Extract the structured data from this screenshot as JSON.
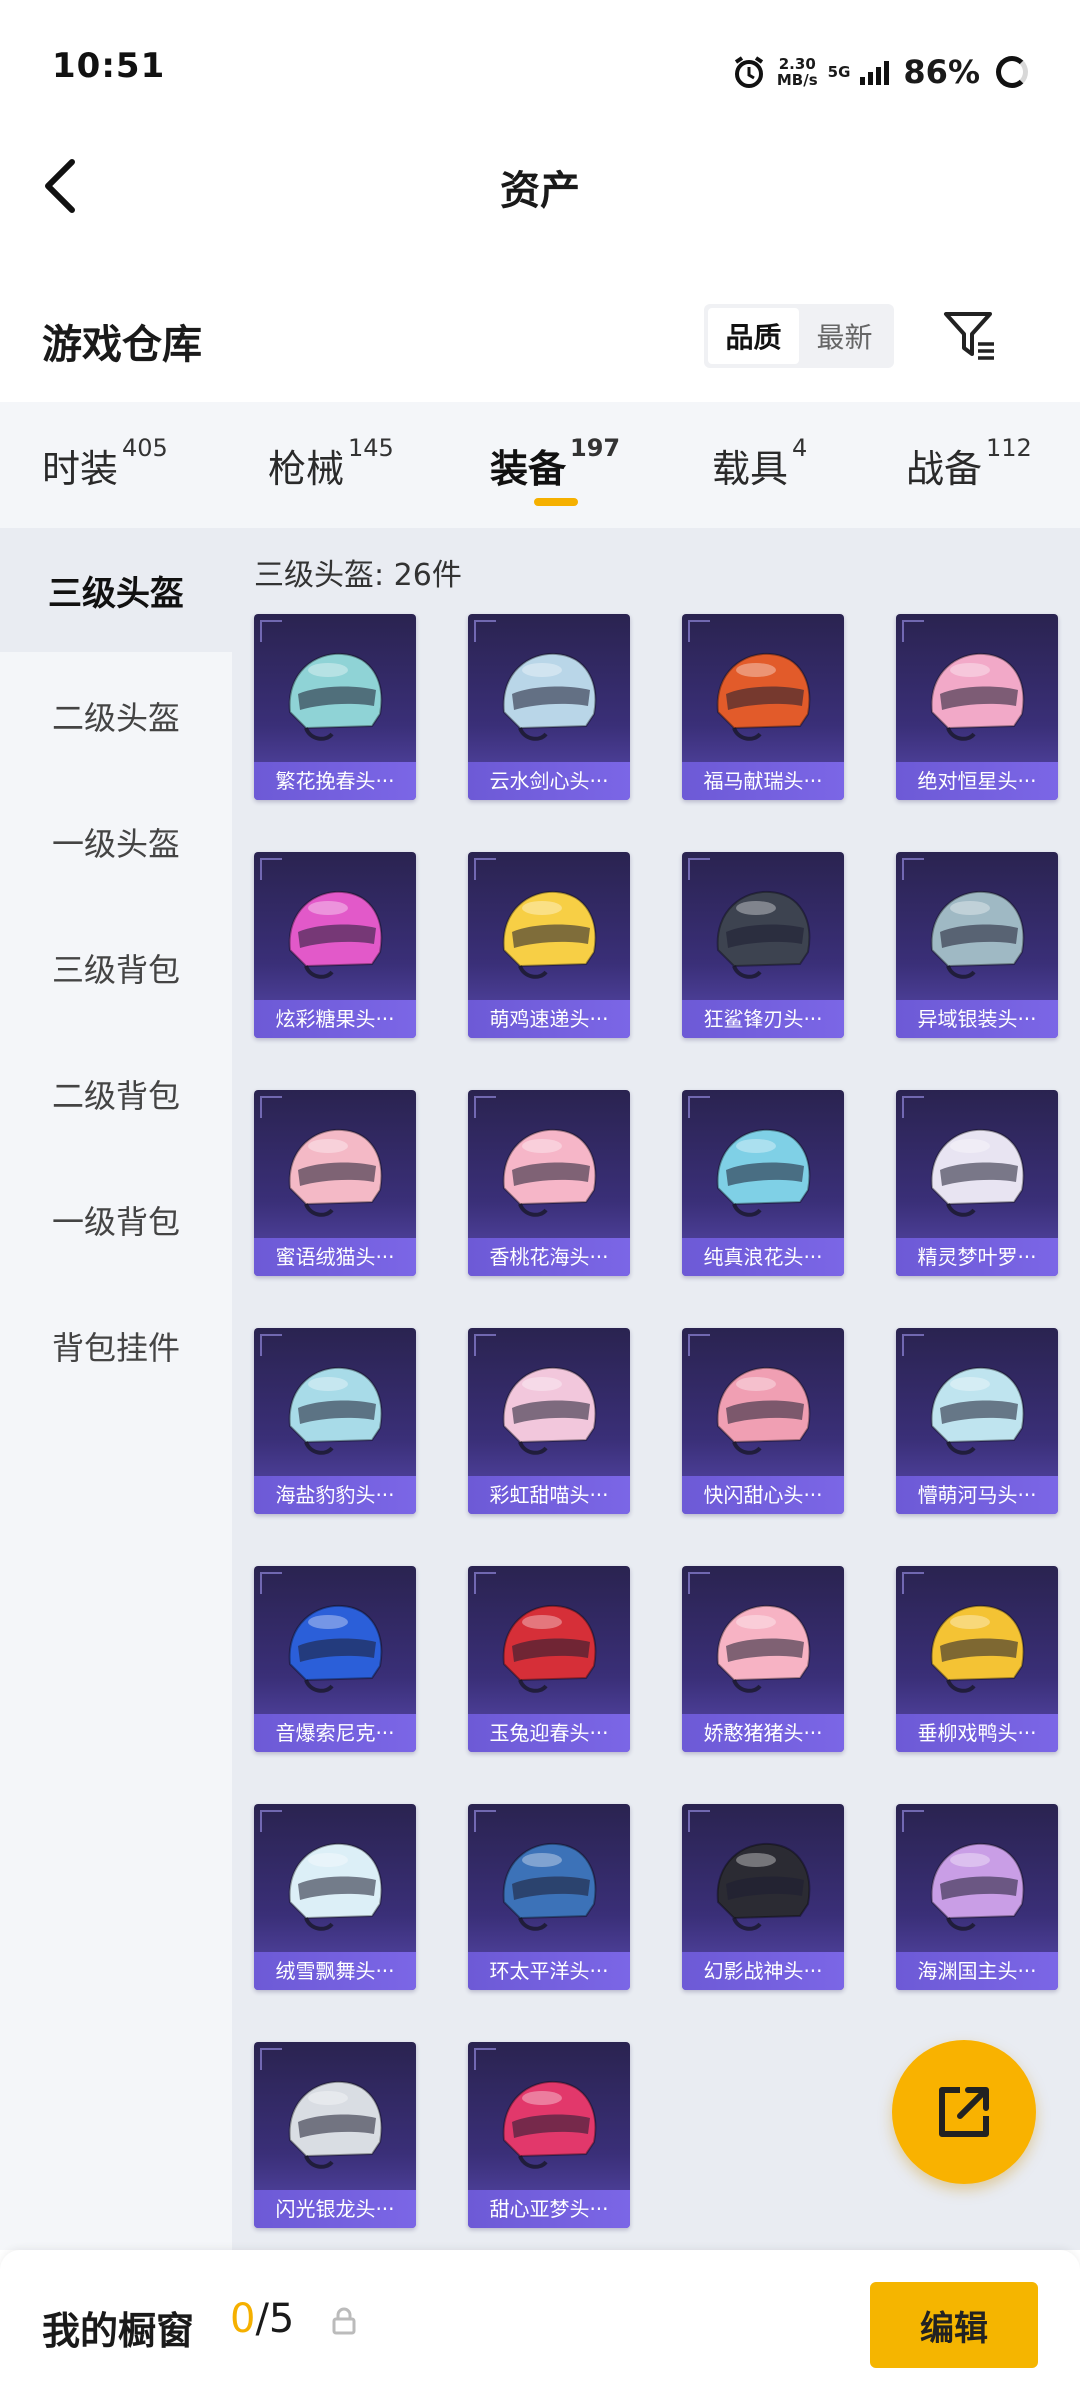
{
  "status_bar": {
    "time": "10:51",
    "net_speed_value": "2.30",
    "net_speed_unit": "MB/s",
    "network": "5G",
    "battery": "86%"
  },
  "header": {
    "title": "资产"
  },
  "warehouse": {
    "title": "游戏仓库",
    "sort_options": [
      "品质",
      "最新"
    ]
  },
  "tabs": [
    {
      "label": "时装",
      "count": "405"
    },
    {
      "label": "枪械",
      "count": "145"
    },
    {
      "label": "装备",
      "count": "197",
      "active": true
    },
    {
      "label": "载具",
      "count": "4"
    },
    {
      "label": "战备",
      "count": "112"
    }
  ],
  "sidebar": {
    "items": [
      {
        "label": "三级头盔",
        "active": true
      },
      {
        "label": "二级头盔"
      },
      {
        "label": "一级头盔"
      },
      {
        "label": "三级背包"
      },
      {
        "label": "二级背包"
      },
      {
        "label": "一级背包"
      },
      {
        "label": "背包挂件"
      }
    ]
  },
  "grid": {
    "count_label": "三级头盔: 26件",
    "items": [
      {
        "name": "繁花挽春头···",
        "color": "#8fd3d6"
      },
      {
        "name": "云水剑心头···",
        "color": "#b9d6e8"
      },
      {
        "name": "福马献瑞头···",
        "color": "#e25b2a"
      },
      {
        "name": "绝对恒星头···",
        "color": "#f2a9c8"
      },
      {
        "name": "炫彩糖果头···",
        "color": "#e259c9"
      },
      {
        "name": "萌鸡速递头···",
        "color": "#f7cf45"
      },
      {
        "name": "狂鲨锋刃头···",
        "color": "#3d4350"
      },
      {
        "name": "异域银装头···",
        "color": "#9fb9c4"
      },
      {
        "name": "蜜语绒猫头···",
        "color": "#f4b9c6"
      },
      {
        "name": "香桃花海头···",
        "color": "#f6b6c8"
      },
      {
        "name": "纯真浪花头···",
        "color": "#7fd0e6"
      },
      {
        "name": "精灵梦叶罗···",
        "color": "#e8e4f2"
      },
      {
        "name": "海盐豹豹头···",
        "color": "#a8dbe8"
      },
      {
        "name": "彩虹甜喵头···",
        "color": "#f2c7dc"
      },
      {
        "name": "快闪甜心头···",
        "color": "#f09fb3"
      },
      {
        "name": "懵萌河马头···",
        "color": "#bfe4ef"
      },
      {
        "name": "音爆索尼克···",
        "color": "#2b5fd9"
      },
      {
        "name": "玉兔迎春头···",
        "color": "#d62f38"
      },
      {
        "name": "娇憨猪猪头···",
        "color": "#f7b3c4"
      },
      {
        "name": "垂柳戏鸭头···",
        "color": "#f4c334"
      },
      {
        "name": "绒雪飘舞头···",
        "color": "#dceff7"
      },
      {
        "name": "环太平洋头···",
        "color": "#3c72b8"
      },
      {
        "name": "幻影战神头···",
        "color": "#2b2b33"
      },
      {
        "name": "海渊国主头···",
        "color": "#c99ee6"
      },
      {
        "name": "闪光银龙头···",
        "color": "#d9dde3"
      },
      {
        "name": "甜心亚梦头···",
        "color": "#e2386b"
      }
    ]
  },
  "bottom_bar": {
    "label": "我的橱窗",
    "current": "0",
    "total": "/5",
    "edit_label": "编辑"
  },
  "colors": {
    "accent": "#f5b000",
    "card_bg": "#3a2f78",
    "card_label_bg": "#7060dc"
  }
}
